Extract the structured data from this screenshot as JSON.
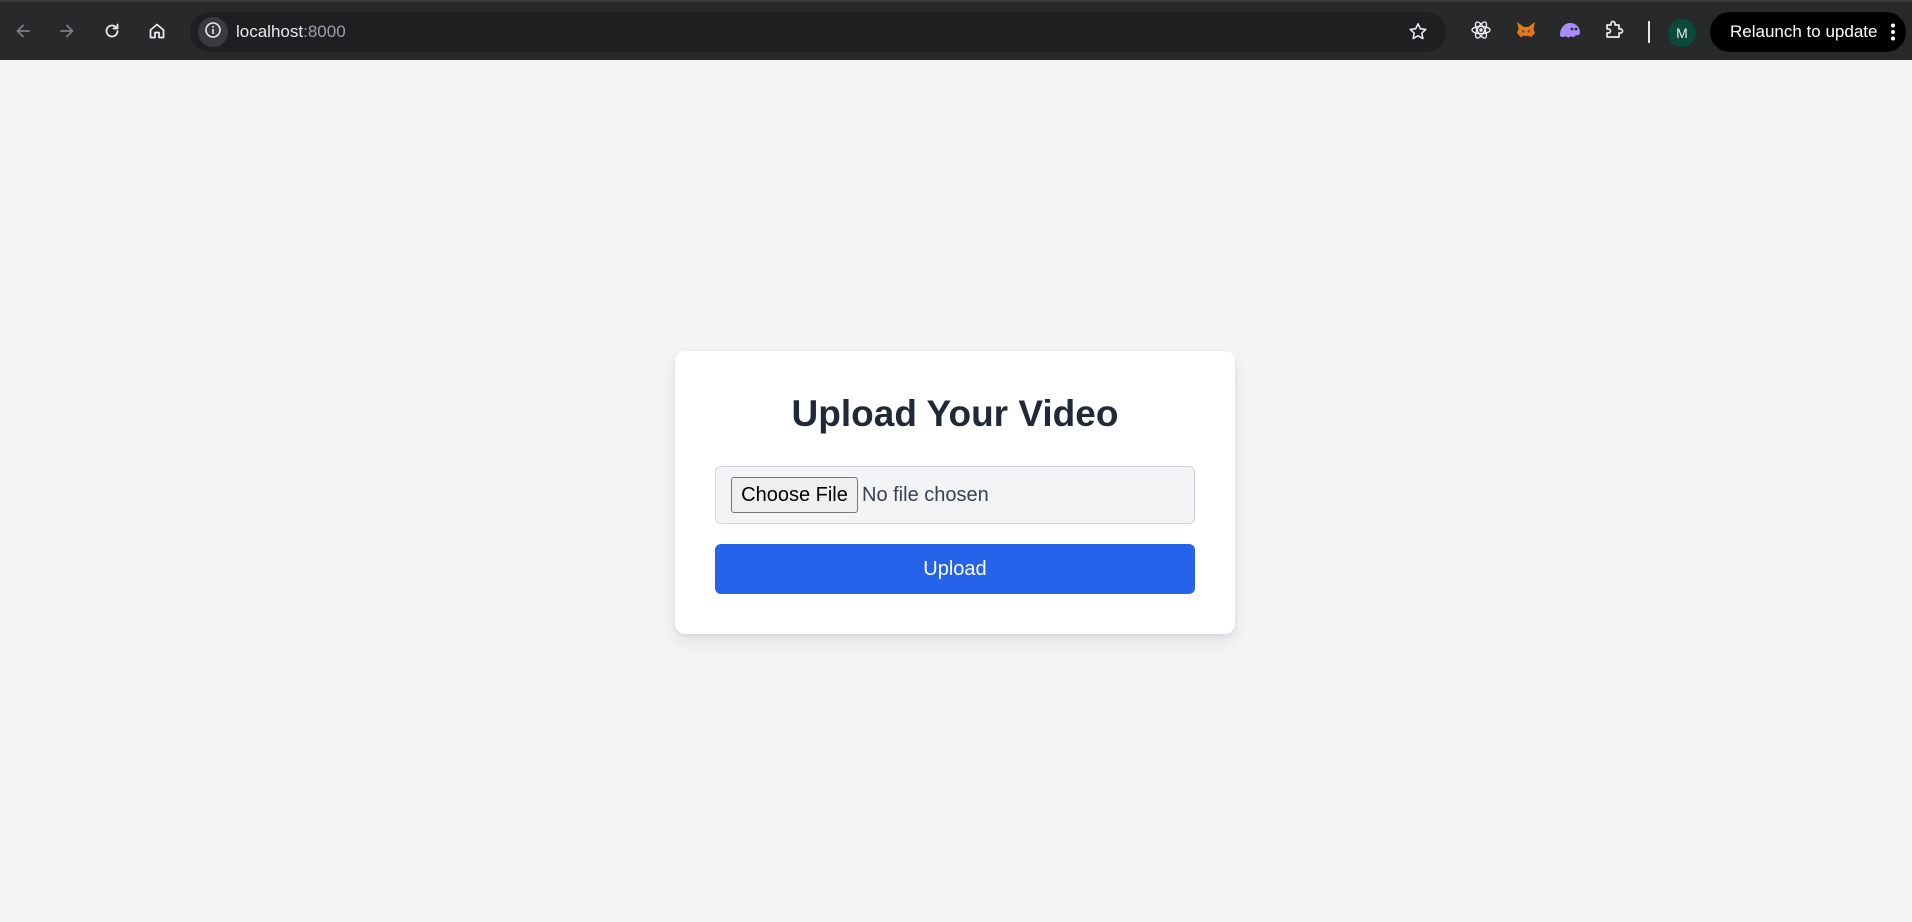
{
  "browser": {
    "url_host": "localhost",
    "url_port": ":8000",
    "profile_initial": "M",
    "relaunch_label": "Relaunch to update",
    "icons": {
      "back": "back-arrow-icon",
      "forward": "forward-arrow-icon",
      "reload": "reload-icon",
      "home": "home-icon",
      "site_info": "info-icon",
      "bookmark": "star-icon",
      "extensions": [
        "react-devtools-icon",
        "metamask-fox-icon",
        "ghost-extension-icon",
        "puzzle-extensions-icon"
      ],
      "menu": "kebab-menu-icon"
    },
    "colors": {
      "toolbar": "#28292b",
      "omnibox": "#1e1f21",
      "relaunch": "#000000",
      "avatar": "#0b4a3a"
    }
  },
  "page": {
    "title": "Upload Your Video",
    "file_input": {
      "button_label": "Choose File",
      "status": "No file chosen"
    },
    "upload_label": "Upload",
    "colors": {
      "background": "#f3f4f6",
      "card": "#ffffff",
      "title": "#1f2937",
      "primary": "#2563eb"
    }
  }
}
